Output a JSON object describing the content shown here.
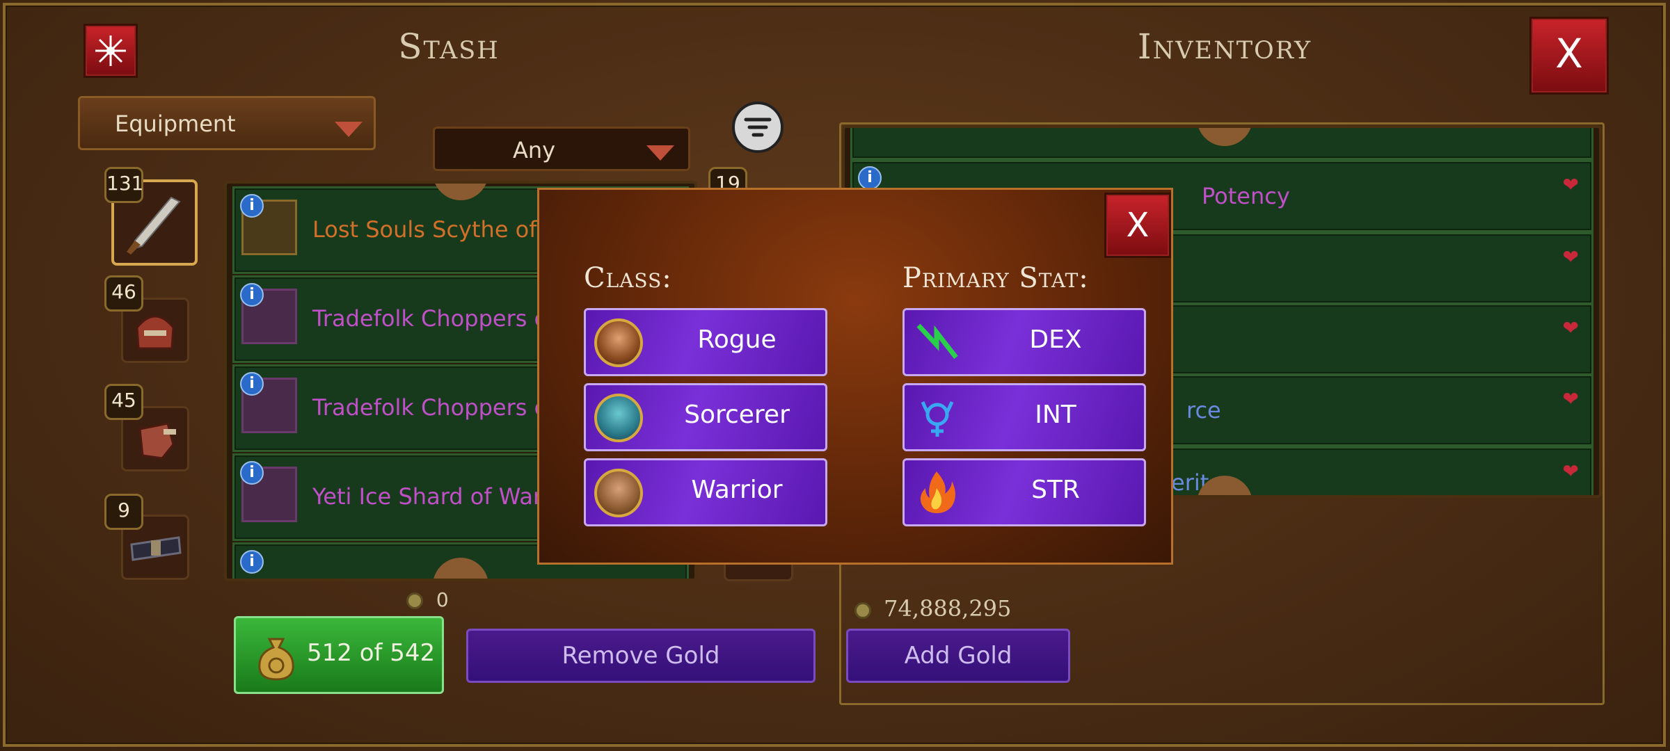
{
  "stash": {
    "title": "Stash",
    "category_dropdown": "Equipment",
    "filter_dropdown": "Any",
    "categories": [
      {
        "count": "131",
        "icon": "dagger-icon"
      },
      {
        "count": "46",
        "icon": "helmet-icon"
      },
      {
        "count": "45",
        "icon": "gauntlet-icon"
      },
      {
        "count": "9",
        "icon": "belt-icon"
      }
    ],
    "items": [
      {
        "name": "Lost Souls Scythe of Fe",
        "color": "#d0702a"
      },
      {
        "name": "Tradefolk Choppers of",
        "color": "#c050c8"
      },
      {
        "name": "Tradefolk Choppers of",
        "color": "#c050c8"
      },
      {
        "name": "Yeti Ice Shard of War",
        "color": "#c050c8"
      }
    ],
    "partial_badge": "19",
    "gold": "0",
    "capacity": "512 of 542",
    "remove_gold_label": "Remove Gold"
  },
  "inventory": {
    "title": "Inventory",
    "items": [
      {
        "name": "Potency"
      },
      {
        "name": ""
      },
      {
        "name": ""
      },
      {
        "name": "rce"
      },
      {
        "name": "erit"
      }
    ],
    "gold": "74,888,295",
    "add_gold_label": "Add Gold",
    "close_label": "X"
  },
  "filter_modal": {
    "close_label": "X",
    "class_label": "Class:",
    "stat_label": "Primary Stat:",
    "classes": [
      {
        "label": "Rogue",
        "portrait": "rogue-portrait"
      },
      {
        "label": "Sorcerer",
        "portrait": "sorcerer-portrait"
      },
      {
        "label": "Warrior",
        "portrait": "warrior-portrait"
      }
    ],
    "stats": [
      {
        "label": "DEX",
        "icon": "dex-icon"
      },
      {
        "label": "INT",
        "icon": "int-icon"
      },
      {
        "label": "STR",
        "icon": "str-icon"
      }
    ]
  }
}
